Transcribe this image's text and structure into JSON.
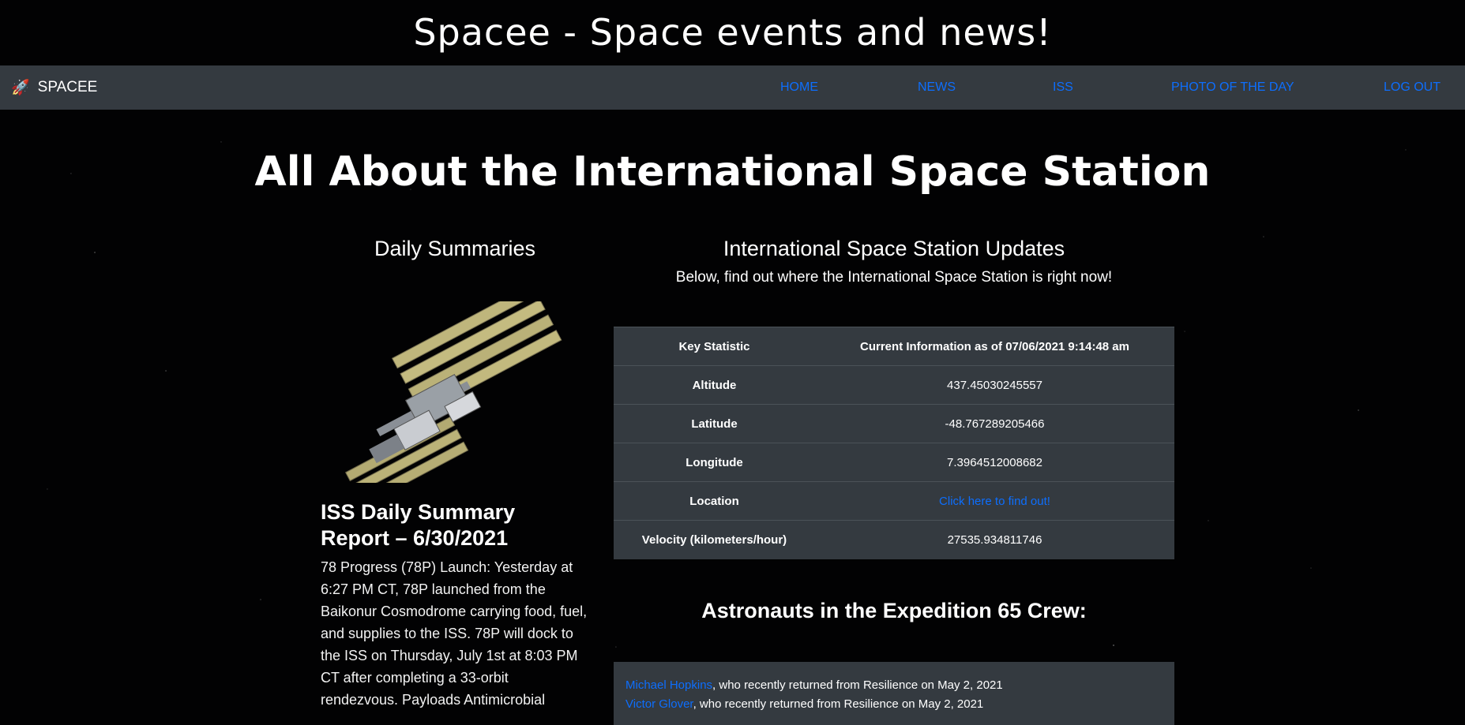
{
  "site_title": "Spacee - Space events and news!",
  "navbar": {
    "brand": "SPACEE",
    "links": [
      "HOME",
      "NEWS",
      "ISS",
      "PHOTO OF THE DAY",
      "LOG OUT"
    ]
  },
  "page_heading": "All About the International Space Station",
  "left": {
    "heading": "Daily Summaries",
    "report_title": "ISS Daily Summary Report – 6/30/2021",
    "report_body": "78 Progress (78P) Launch: Yesterday at 6:27 PM CT, 78P launched from the Baikonur Cosmodrome carrying food, fuel, and supplies to the ISS. 78P will dock to the ISS on Thursday, July 1st at 8:03 PM CT after completing a 33-orbit rendezvous. Payloads Antimicrobial"
  },
  "right": {
    "heading": "International Space Station Updates",
    "subheading": "Below, find out where the International Space Station is right now!",
    "table": {
      "headers": [
        "Key Statistic",
        "Current Information as of 07/06/2021 9:14:48 am"
      ],
      "rows": [
        {
          "key": "Altitude",
          "value": "437.45030245557"
        },
        {
          "key": "Latitude",
          "value": "-48.767289205466"
        },
        {
          "key": "Longitude",
          "value": "7.3964512008682"
        },
        {
          "key": "Location",
          "value": "Click here to find out!"
        },
        {
          "key": "Velocity (kilometers/hour)",
          "value": "27535.934811746"
        }
      ]
    },
    "crew_heading": "Astronauts in the Expedition 65 Crew:",
    "crew": [
      {
        "name": "Michael Hopkins",
        "note": ", who recently returned from Resilience on May 2, 2021"
      },
      {
        "name": "Victor Glover",
        "note": ", who recently returned from Resilience on May 2, 2021"
      }
    ]
  },
  "colors": {
    "nav_bg": "#343a40",
    "link": "#0d6efd",
    "background": "#020203"
  }
}
